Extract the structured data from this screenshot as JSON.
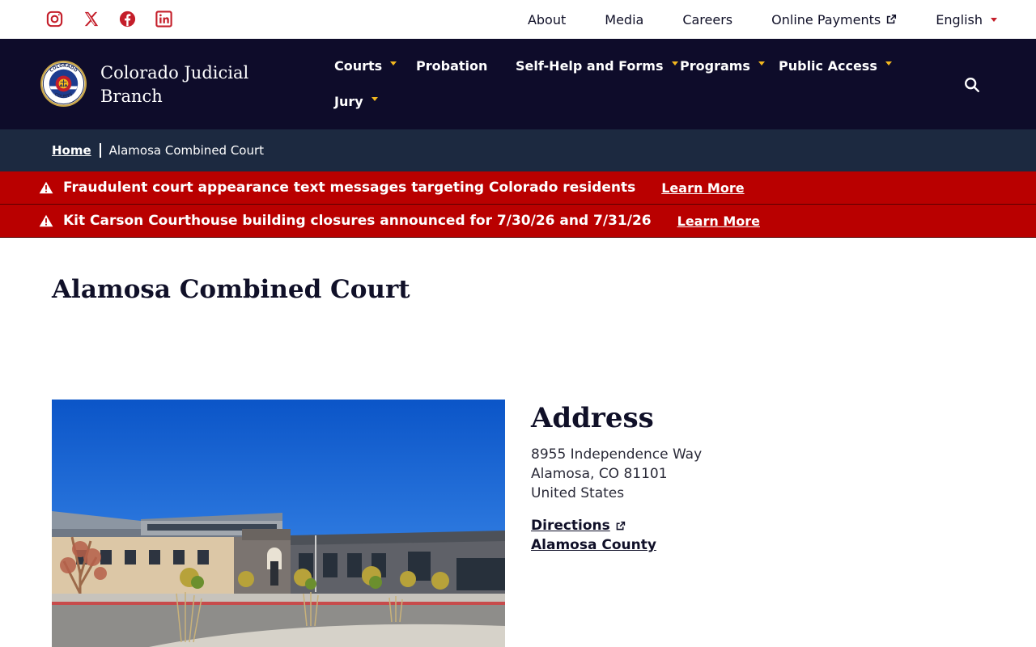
{
  "social": {
    "icons": [
      "instagram-icon",
      "x-twitter-icon",
      "facebook-icon",
      "linkedin-icon"
    ],
    "color": "#c41e2a"
  },
  "utility_nav": {
    "about": "About",
    "media": "Media",
    "careers": "Careers",
    "online_payments": "Online Payments",
    "language": "English"
  },
  "brand": {
    "name_line1": "Colorado Judicial",
    "name_line2": "Branch",
    "seal_text_top": "COLORADO",
    "seal_text_bottom": "COURTS"
  },
  "main_nav": {
    "courts": "Courts",
    "probation": "Probation",
    "self_help": "Self-Help and Forms",
    "programs": "Programs",
    "public_access": "Public Access",
    "jury": "Jury"
  },
  "breadcrumb": {
    "home": "Home",
    "current": "Alamosa Combined Court"
  },
  "alerts": [
    {
      "text": "Fraudulent court appearance text messages targeting Colorado residents",
      "link": "Learn More"
    },
    {
      "text": "Kit Carson Courthouse building closures announced for 7/30/26 and 7/31/26",
      "link": "Learn More"
    }
  ],
  "page": {
    "title": "Alamosa Combined Court"
  },
  "address": {
    "heading": "Address",
    "street": "8955 Independence Way",
    "city_line": "Alamosa, CO 81101",
    "country": "United States",
    "directions": "Directions",
    "county": "Alamosa County"
  },
  "colors": {
    "nav_bg": "#0e0c2a",
    "breadcrumb_bg": "#1c2940",
    "alert_bg": "#b90000",
    "accent_gold": "#f2b71f",
    "accent_red": "#c41e2a"
  }
}
